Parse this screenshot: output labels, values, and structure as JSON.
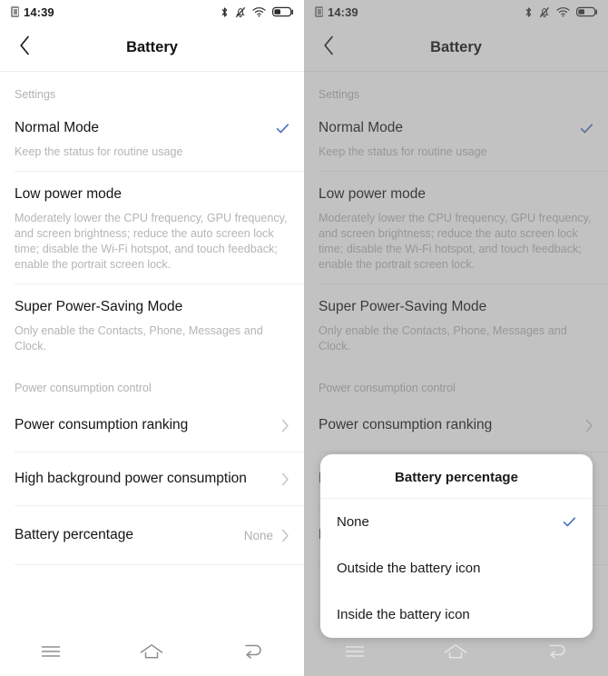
{
  "status_bar": {
    "time": "14:39",
    "left_icon": "sim-card-icon",
    "icons": [
      "bluetooth-icon",
      "notifications-muted-icon",
      "wifi-icon",
      "battery-icon"
    ]
  },
  "header": {
    "title": "Battery",
    "back_icon": "chevron-left-icon"
  },
  "colors": {
    "accent_check": "#4a6fbe",
    "annotation": "#0000ee",
    "dim_overlay": "#6e6e6e",
    "muted_text": "#b5b5b5"
  },
  "sections": [
    {
      "label": "Settings",
      "rows": [
        {
          "title": "Normal Mode",
          "desc": "Keep the status for routine usage",
          "checked": true
        },
        {
          "title": "Low power mode",
          "desc": "Moderately lower the CPU frequency, GPU frequency, and screen brightness; reduce the auto screen lock time; disable the Wi-Fi hotspot, and touch feedback; enable the portrait screen lock.",
          "checked": false
        },
        {
          "title": "Super Power-Saving Mode",
          "desc": "Only enable the Contacts, Phone, Messages and Clock.",
          "checked": false
        }
      ]
    },
    {
      "label": "Power consumption control",
      "rows": [
        {
          "title": "Power consumption ranking",
          "value": "",
          "chevron": true
        },
        {
          "title": "High background power consumption",
          "value": "",
          "chevron": true
        },
        {
          "title": "Battery percentage",
          "value": "None",
          "chevron": true
        }
      ]
    }
  ],
  "bottom_nav": {
    "items": [
      {
        "name": "recents-menu-icon"
      },
      {
        "name": "home-icon"
      },
      {
        "name": "back-icon"
      }
    ]
  },
  "dialog": {
    "title": "Battery percentage",
    "options": [
      {
        "label": "None",
        "selected": true
      },
      {
        "label": "Outside the battery icon",
        "selected": false
      },
      {
        "label": "Inside the battery icon",
        "selected": false
      }
    ]
  },
  "annotations": [
    {
      "target": "Outside the battery icon"
    },
    {
      "target": "Inside the battery icon"
    }
  ]
}
